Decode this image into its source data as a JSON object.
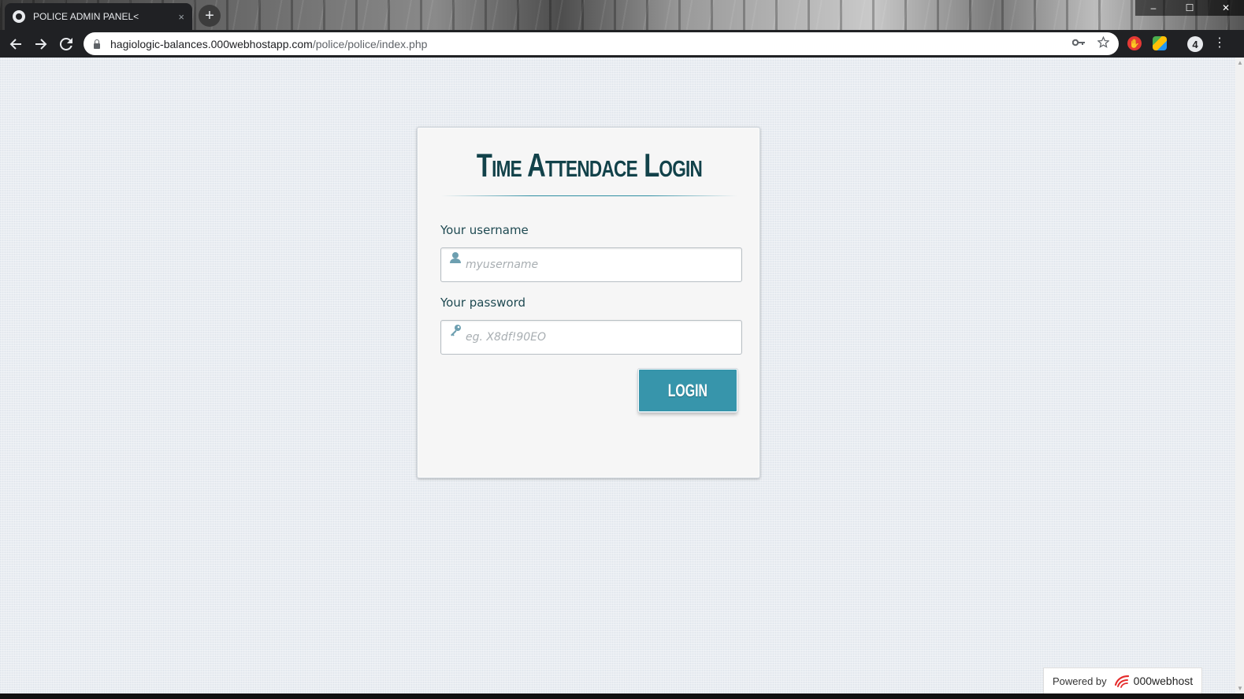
{
  "browser": {
    "tab_title": "POLICE ADMIN PANEL<",
    "tab_close": "×",
    "new_tab": "+",
    "url_host": "hagiologic-balances.000webhostapp.com",
    "url_path": "/police/police/index.php",
    "ext_badge": "4",
    "window_controls": {
      "minimize": "–",
      "maximize": "☐",
      "close": "✕"
    }
  },
  "login": {
    "title": "Time Attendace Login",
    "username_label": "Your username",
    "username_placeholder": "myusername",
    "password_label": "Your password",
    "password_placeholder": "eg. X8df!90EO",
    "button_label": "LOGIN"
  },
  "footer": {
    "powered_by": "Powered by",
    "brand": "000webhost"
  },
  "colors": {
    "accent": "#3795ab",
    "title": "#12424a",
    "page_bg": "#e9edf2"
  }
}
